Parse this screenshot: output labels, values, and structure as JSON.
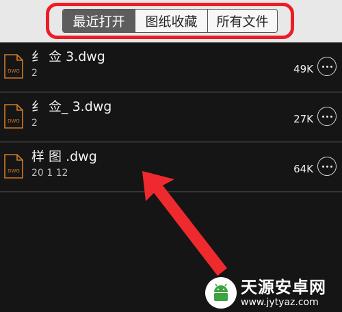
{
  "tabs": [
    {
      "label": "最近打开",
      "active": true
    },
    {
      "label": "图纸收藏",
      "active": false
    },
    {
      "label": "所有文件",
      "active": false
    }
  ],
  "files": [
    {
      "name": "纟 佥 3.dwg",
      "date": "2",
      "size": "49K",
      "icon": "dwg-file-icon"
    },
    {
      "name": "纟 佥_ 3.dwg",
      "date": "2",
      "size": "27K",
      "icon": "dwg-file-icon"
    },
    {
      "name": "样  图 .dwg",
      "date": "20 1 12",
      "size": "64K",
      "icon": "dwg-file-icon"
    }
  ],
  "file_icon_label": "DWG",
  "watermark": {
    "title": "天源安卓网",
    "url": "www.jytyaz.com"
  },
  "colors": {
    "highlight": "#ee1c25",
    "arrow": "#ee2a2e",
    "icon": "#d07a2a",
    "background": "#151515"
  }
}
